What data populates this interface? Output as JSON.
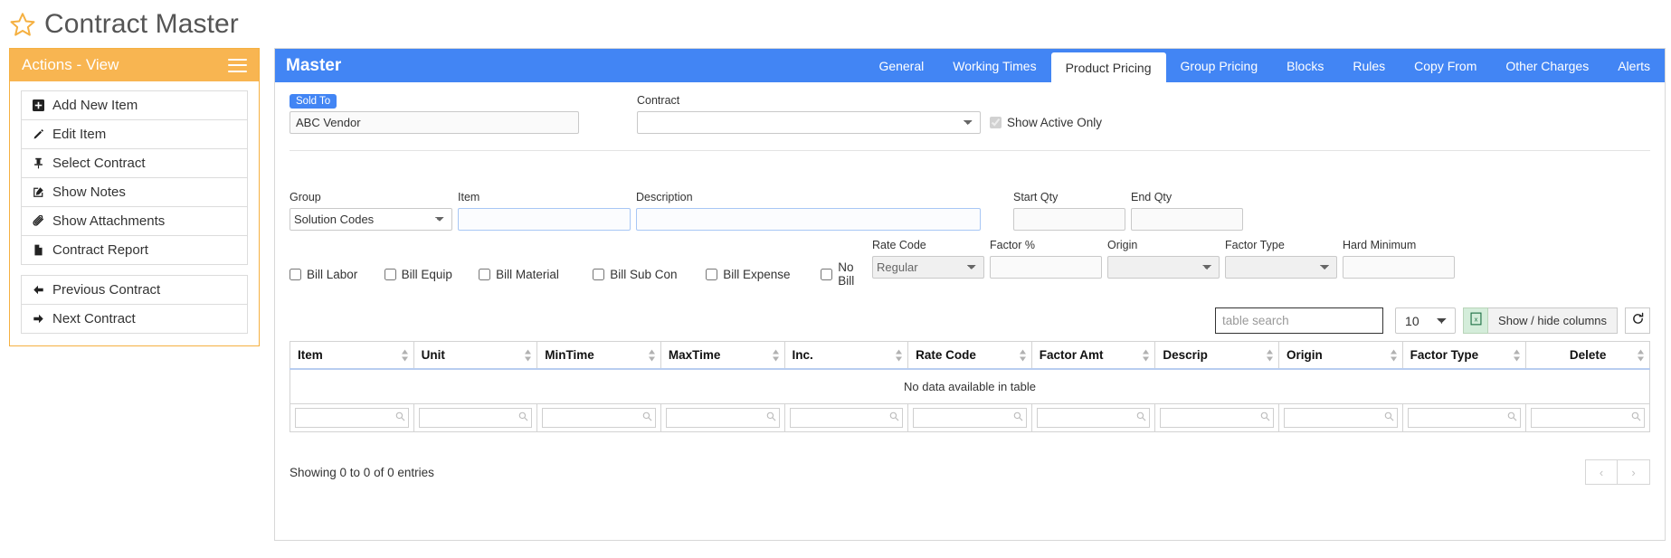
{
  "page": {
    "title": "Contract Master",
    "star_icon": "star-outline-icon"
  },
  "sidebar": {
    "header": "Actions - View",
    "menu_icon": "hamburger-icon",
    "groups": [
      {
        "items": [
          {
            "label": "Add New Item",
            "icon": "plus-square-icon"
          },
          {
            "label": "Edit Item",
            "icon": "pencil-icon"
          },
          {
            "label": "Select Contract",
            "icon": "pin-icon"
          },
          {
            "label": "Show Notes",
            "icon": "note-edit-icon"
          },
          {
            "label": "Show Attachments",
            "icon": "paperclip-icon"
          },
          {
            "label": "Contract Report",
            "icon": "file-icon"
          }
        ]
      },
      {
        "items": [
          {
            "label": "Previous Contract",
            "icon": "arrow-left-icon"
          },
          {
            "label": "Next Contract",
            "icon": "arrow-right-icon"
          }
        ]
      }
    ]
  },
  "main": {
    "title": "Master",
    "accent_color": "#4285f4",
    "tabs": [
      {
        "label": "General",
        "active": false
      },
      {
        "label": "Working Times",
        "active": false
      },
      {
        "label": "Product Pricing",
        "active": true
      },
      {
        "label": "Group Pricing",
        "active": false
      },
      {
        "label": "Blocks",
        "active": false
      },
      {
        "label": "Rules",
        "active": false
      },
      {
        "label": "Copy From",
        "active": false
      },
      {
        "label": "Other Charges",
        "active": false
      },
      {
        "label": "Alerts",
        "active": false
      }
    ],
    "header_row": {
      "sold_to_label": "Sold To",
      "sold_to_value": "ABC Vendor",
      "contract_label": "Contract",
      "contract_value": "",
      "show_active_only_label": "Show Active Only",
      "show_active_only_checked": true
    },
    "filters": {
      "group_label": "Group",
      "group_value": "Solution Codes",
      "item_label": "Item",
      "item_value": "",
      "description_label": "Description",
      "description_value": "",
      "start_qty_label": "Start Qty",
      "start_qty_value": "",
      "end_qty_label": "End Qty",
      "end_qty_value": "",
      "rate_code_label": "Rate Code",
      "rate_code_value": "Regular",
      "factor_pct_label": "Factor %",
      "factor_pct_value": "",
      "origin_label": "Origin",
      "origin_value": "",
      "factor_type_label": "Factor Type",
      "factor_type_value": "",
      "hard_minimum_label": "Hard Minimum",
      "hard_minimum_value": ""
    },
    "bill_checkboxes": [
      {
        "label": "Bill Labor",
        "checked": false
      },
      {
        "label": "Bill Equip",
        "checked": false
      },
      {
        "label": "Bill Material",
        "checked": false
      },
      {
        "label": "Bill Sub Con",
        "checked": false
      },
      {
        "label": "Bill Expense",
        "checked": false
      },
      {
        "label": "No Bill",
        "checked": false
      }
    ],
    "table_toolbar": {
      "search_placeholder": "table search",
      "search_value": "",
      "page_size": "10",
      "excel_icon": "excel-export-icon",
      "columns_button": "Show / hide columns",
      "refresh_icon": "refresh-icon"
    },
    "table": {
      "columns": [
        "Item",
        "Unit",
        "MinTime",
        "MaxTime",
        "Inc.",
        "Rate Code",
        "Factor Amt",
        "Descrip",
        "Origin",
        "Factor Type",
        "Delete"
      ],
      "rows": [],
      "empty_message": "No data available in table",
      "column_search_icon": "magnifier-icon"
    },
    "footer": {
      "showing": "Showing 0 to 0 of 0 entries",
      "prev_label": "‹",
      "next_label": "›"
    }
  }
}
